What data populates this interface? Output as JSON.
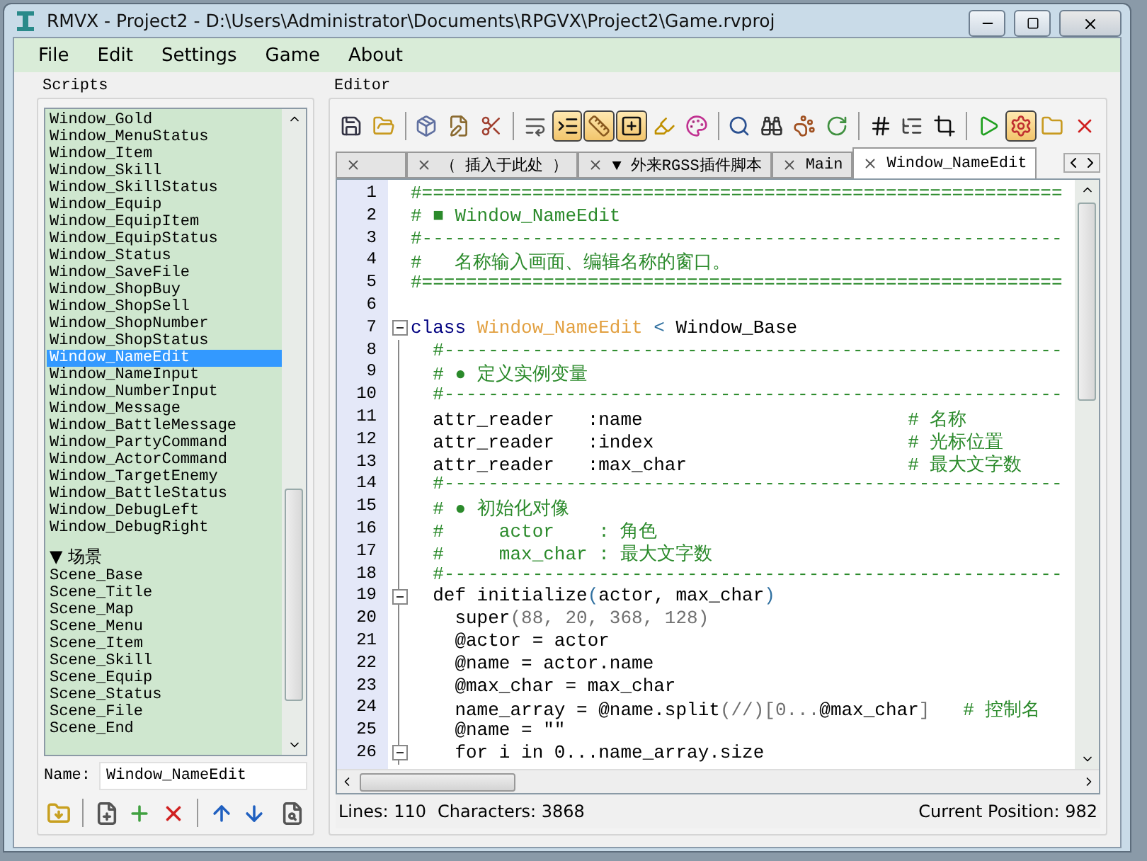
{
  "window": {
    "title": "RMVX - Project2 - D:\\Users\\Administrator\\Documents\\RPGVX\\Project2\\Game.rvproj"
  },
  "menu": [
    "File",
    "Edit",
    "Settings",
    "Game",
    "About"
  ],
  "scripts": {
    "title": "Scripts",
    "items": [
      {
        "kind": "script",
        "label": "Window_Gold",
        "selected": false
      },
      {
        "kind": "script",
        "label": "Window_MenuStatus",
        "selected": false
      },
      {
        "kind": "script",
        "label": "Window_Item",
        "selected": false
      },
      {
        "kind": "script",
        "label": "Window_Skill",
        "selected": false
      },
      {
        "kind": "script",
        "label": "Window_SkillStatus",
        "selected": false
      },
      {
        "kind": "script",
        "label": "Window_Equip",
        "selected": false
      },
      {
        "kind": "script",
        "label": "Window_EquipItem",
        "selected": false
      },
      {
        "kind": "script",
        "label": "Window_EquipStatus",
        "selected": false
      },
      {
        "kind": "script",
        "label": "Window_Status",
        "selected": false
      },
      {
        "kind": "script",
        "label": "Window_SaveFile",
        "selected": false
      },
      {
        "kind": "script",
        "label": "Window_ShopBuy",
        "selected": false
      },
      {
        "kind": "script",
        "label": "Window_ShopSell",
        "selected": false
      },
      {
        "kind": "script",
        "label": "Window_ShopNumber",
        "selected": false
      },
      {
        "kind": "script",
        "label": "Window_ShopStatus",
        "selected": false
      },
      {
        "kind": "script",
        "label": "Window_NameEdit",
        "selected": true
      },
      {
        "kind": "script",
        "label": "Window_NameInput",
        "selected": false
      },
      {
        "kind": "script",
        "label": "Window_NumberInput",
        "selected": false
      },
      {
        "kind": "script",
        "label": "Window_Message",
        "selected": false
      },
      {
        "kind": "script",
        "label": "Window_BattleMessage",
        "selected": false
      },
      {
        "kind": "script",
        "label": "Window_PartyCommand",
        "selected": false
      },
      {
        "kind": "script",
        "label": "Window_ActorCommand",
        "selected": false
      },
      {
        "kind": "script",
        "label": "Window_TargetEnemy",
        "selected": false
      },
      {
        "kind": "script",
        "label": "Window_BattleStatus",
        "selected": false
      },
      {
        "kind": "script",
        "label": "Window_DebugLeft",
        "selected": false
      },
      {
        "kind": "script",
        "label": "Window_DebugRight",
        "selected": false
      },
      {
        "kind": "header",
        "label": "▼ 场景",
        "selected": false
      },
      {
        "kind": "script",
        "label": "Scene_Base",
        "selected": false
      },
      {
        "kind": "script",
        "label": "Scene_Title",
        "selected": false
      },
      {
        "kind": "script",
        "label": "Scene_Map",
        "selected": false
      },
      {
        "kind": "script",
        "label": "Scene_Menu",
        "selected": false
      },
      {
        "kind": "script",
        "label": "Scene_Item",
        "selected": false
      },
      {
        "kind": "script",
        "label": "Scene_Skill",
        "selected": false
      },
      {
        "kind": "script",
        "label": "Scene_Equip",
        "selected": false
      },
      {
        "kind": "script",
        "label": "Scene_Status",
        "selected": false
      },
      {
        "kind": "script",
        "label": "Scene_File",
        "selected": false
      },
      {
        "kind": "script",
        "label": "Scene_End",
        "selected": false
      }
    ],
    "name_label": "Name:",
    "name_value": "Window_NameEdit",
    "buttons": [
      {
        "kind": "button"
      },
      {
        "kind": "separator"
      },
      {
        "kind": "button"
      },
      {
        "kind": "button"
      },
      {
        "kind": "button"
      },
      {
        "kind": "separator"
      },
      {
        "kind": "button"
      },
      {
        "kind": "button"
      },
      {
        "kind": "spacer"
      },
      {
        "kind": "button"
      }
    ]
  },
  "editor": {
    "title": "Editor",
    "toolbar": [
      {
        "kind": "button",
        "pressed": false
      },
      {
        "kind": "button",
        "pressed": false
      },
      {
        "kind": "separator"
      },
      {
        "kind": "button",
        "pressed": false
      },
      {
        "kind": "button",
        "pressed": false
      },
      {
        "kind": "button",
        "pressed": false
      },
      {
        "kind": "separator"
      },
      {
        "kind": "button",
        "pressed": false
      },
      {
        "kind": "button",
        "pressed": true
      },
      {
        "kind": "button",
        "pressed": true
      },
      {
        "kind": "button",
        "pressed": true
      },
      {
        "kind": "button",
        "pressed": false
      },
      {
        "kind": "button",
        "pressed": false
      },
      {
        "kind": "separator"
      },
      {
        "kind": "button",
        "pressed": false
      },
      {
        "kind": "button",
        "pressed": false
      },
      {
        "kind": "button",
        "pressed": false
      },
      {
        "kind": "button",
        "pressed": false
      },
      {
        "kind": "separator"
      },
      {
        "kind": "button",
        "pressed": false
      },
      {
        "kind": "button",
        "pressed": false
      },
      {
        "kind": "button",
        "pressed": false
      },
      {
        "kind": "separator"
      },
      {
        "kind": "button",
        "pressed": false
      },
      {
        "kind": "button",
        "pressed": true
      },
      {
        "kind": "button",
        "pressed": false
      },
      {
        "kind": "button",
        "pressed": false
      }
    ],
    "tabs": [
      {
        "selected": false
      },
      {
        "label": "（ 插入于此处 ）",
        "selected": false
      },
      {
        "label": "▼ 外来RGSS插件脚本",
        "selected": false
      },
      {
        "label": "Main",
        "selected": false
      },
      {
        "label": "Window_NameEdit",
        "selected": true
      }
    ],
    "lines": [
      {
        "number": "1",
        "kind": "line",
        "tokens": [
          {
            "kind": "comment",
            "text": "#=========================================================="
          }
        ]
      },
      {
        "number": "2",
        "kind": "line",
        "tokens": [
          {
            "kind": "comment",
            "text": "# ■ Window_NameEdit"
          }
        ]
      },
      {
        "number": "3",
        "kind": "line",
        "tokens": [
          {
            "kind": "comment",
            "text": "#----------------------------------------------------------"
          }
        ]
      },
      {
        "number": "4",
        "kind": "line",
        "tokens": [
          {
            "kind": "comment",
            "text": "#   名称输入画面、编辑名称的窗口。"
          }
        ]
      },
      {
        "number": "5",
        "kind": "line",
        "tokens": [
          {
            "kind": "comment",
            "text": "#=========================================================="
          }
        ]
      },
      {
        "number": "6",
        "kind": "line"
      },
      {
        "number": "7",
        "kind": "fold",
        "tokens": [
          {
            "kind": "keyword",
            "text": "class"
          },
          {
            "kind": "constant",
            "text": " Window_NameEdit"
          },
          {
            "kind": "operator",
            "text": " < "
          },
          {
            "kind": "plain",
            "text": "Window_Base"
          }
        ]
      },
      {
        "number": "8",
        "kind": "line",
        "tokens": [
          {
            "kind": "comment",
            "text": "  #--------------------------------------------------------"
          }
        ]
      },
      {
        "number": "9",
        "kind": "line",
        "tokens": [
          {
            "kind": "comment",
            "text": "  # ● 定义实例变量"
          }
        ]
      },
      {
        "number": "10",
        "kind": "line",
        "tokens": [
          {
            "kind": "comment",
            "text": "  #--------------------------------------------------------"
          }
        ]
      },
      {
        "number": "11",
        "kind": "line",
        "tokens": [
          {
            "kind": "plain",
            "text": "  attr_reader   :name                        "
          },
          {
            "kind": "comment",
            "text": "# 名称"
          }
        ]
      },
      {
        "number": "12",
        "kind": "line",
        "tokens": [
          {
            "kind": "plain",
            "text": "  attr_reader   :index                       "
          },
          {
            "kind": "comment",
            "text": "# 光标位置"
          }
        ]
      },
      {
        "number": "13",
        "kind": "line",
        "tokens": [
          {
            "kind": "plain",
            "text": "  attr_reader   :max_char                    "
          },
          {
            "kind": "comment",
            "text": "# 最大文字数"
          }
        ]
      },
      {
        "number": "14",
        "kind": "line",
        "tokens": [
          {
            "kind": "comment",
            "text": "  #--------------------------------------------------------"
          }
        ]
      },
      {
        "number": "15",
        "kind": "line",
        "tokens": [
          {
            "kind": "comment",
            "text": "  # ● 初始化对像"
          }
        ]
      },
      {
        "number": "16",
        "kind": "line",
        "tokens": [
          {
            "kind": "comment",
            "text": "  #     actor    : 角色"
          }
        ]
      },
      {
        "number": "17",
        "kind": "line",
        "tokens": [
          {
            "kind": "comment",
            "text": "  #     max_char : 最大文字数"
          }
        ]
      },
      {
        "number": "18",
        "kind": "line",
        "tokens": [
          {
            "kind": "comment",
            "text": "  #--------------------------------------------------------"
          }
        ]
      },
      {
        "number": "19",
        "kind": "fold",
        "tokens": [
          {
            "kind": "plain",
            "text": "  def initialize"
          },
          {
            "kind": "operator",
            "text": "("
          },
          {
            "kind": "plain",
            "text": "actor, max_char"
          },
          {
            "kind": "operator",
            "text": ")"
          }
        ]
      },
      {
        "number": "20",
        "kind": "line",
        "tokens": [
          {
            "kind": "plain",
            "text": "    super"
          },
          {
            "kind": "number",
            "text": "(88, 20, 368, 128)"
          }
        ]
      },
      {
        "number": "21",
        "kind": "line",
        "tokens": [
          {
            "kind": "plain",
            "text": "    @actor = actor"
          }
        ]
      },
      {
        "number": "22",
        "kind": "line",
        "tokens": [
          {
            "kind": "plain",
            "text": "    @name = actor.name"
          }
        ]
      },
      {
        "number": "23",
        "kind": "line",
        "tokens": [
          {
            "kind": "plain",
            "text": "    @max_char = max_char"
          }
        ]
      },
      {
        "number": "24",
        "kind": "line",
        "tokens": [
          {
            "kind": "plain",
            "text": "    name_array = @name.split"
          },
          {
            "kind": "number",
            "text": "(//)[0..."
          },
          {
            "kind": "plain",
            "text": "@max_char"
          },
          {
            "kind": "number",
            "text": "]"
          },
          {
            "kind": "comment",
            "text": "   # 控制名"
          }
        ]
      },
      {
        "number": "25",
        "kind": "line",
        "tokens": [
          {
            "kind": "plain",
            "text": "    @name = \"\""
          }
        ]
      },
      {
        "number": "26",
        "kind": "fold",
        "tokens": [
          {
            "kind": "plain",
            "text": "    for i in 0...name_array.size"
          }
        ]
      }
    ]
  },
  "status_bar": {
    "lines": "Lines: 110",
    "characters": "Characters: 3868",
    "position": "Current Position: 982"
  }
}
